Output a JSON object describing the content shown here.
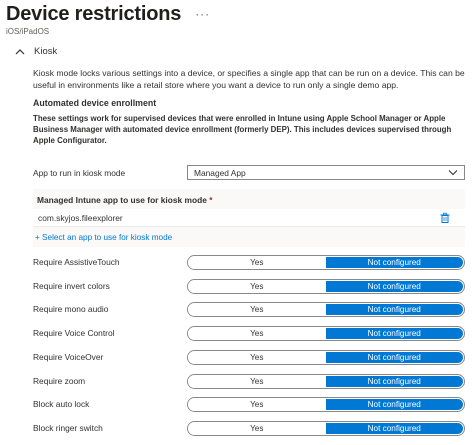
{
  "header": {
    "title": "Device restrictions",
    "more": "···",
    "subtitle": "iOS/iPadOS"
  },
  "section": {
    "title": "Kiosk",
    "description": "Kiosk mode locks various settings into a device, or specifies a single app that can be run on a device. This can be useful in environments like a retail store where you want a device to run only a single demo app.",
    "subheading": "Automated device enrollment",
    "subdescription": "These settings work for supervised devices that were enrolled in Intune using Apple School Manager or Apple Business Manager with automated device enrollment (formerly DEP). This includes devices supervised through Apple Configurator."
  },
  "kiosk_mode": {
    "label": "App to run in kiosk mode",
    "value": "Managed App"
  },
  "managed_app": {
    "label": "Managed Intune app to use for kiosk mode",
    "required_mark": "*",
    "app_name": "com.skyjos.fileexplorer",
    "select_link": "+ Select an app to use for kiosk mode"
  },
  "settings": [
    {
      "label": "Require AssistiveTouch",
      "yes": "Yes",
      "no": "Not configured"
    },
    {
      "label": "Require invert colors",
      "yes": "Yes",
      "no": "Not configured"
    },
    {
      "label": "Require mono audio",
      "yes": "Yes",
      "no": "Not configured"
    },
    {
      "label": "Require Voice Control",
      "yes": "Yes",
      "no": "Not configured"
    },
    {
      "label": "Require VoiceOver",
      "yes": "Yes",
      "no": "Not configured"
    },
    {
      "label": "Require zoom",
      "yes": "Yes",
      "no": "Not configured"
    },
    {
      "label": "Block auto lock",
      "yes": "Yes",
      "no": "Not configured"
    },
    {
      "label": "Block ringer switch",
      "yes": "Yes",
      "no": "Not configured"
    }
  ],
  "colors": {
    "accent": "#0078d4",
    "link": "#0078d4",
    "required": "#a4262c"
  }
}
